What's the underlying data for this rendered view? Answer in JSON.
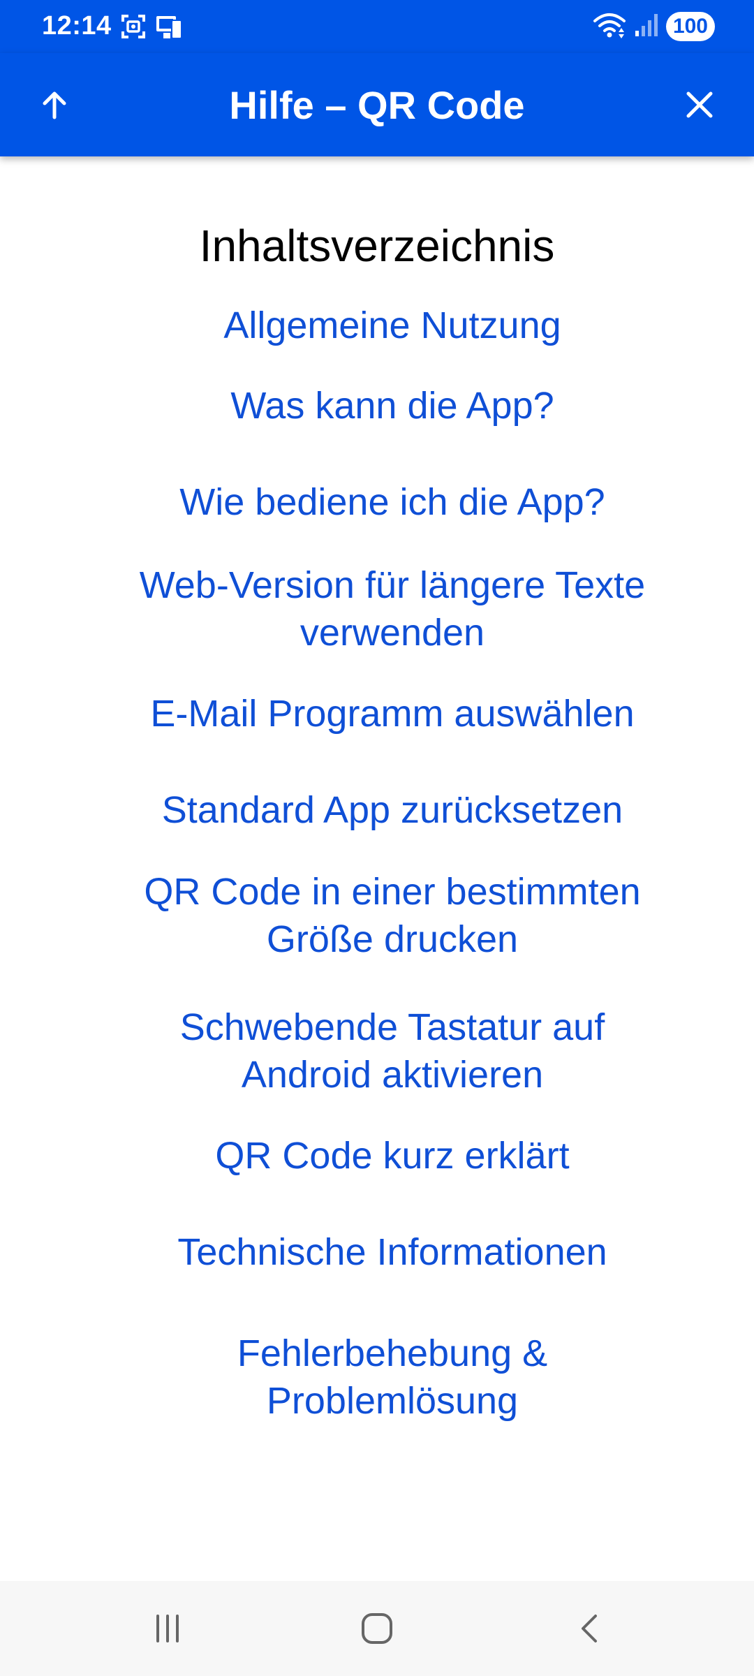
{
  "status_bar": {
    "time": "12:14",
    "battery": "100",
    "icons": [
      "screenshot-icon",
      "phone-link-icon",
      "wifi-icon",
      "signal-icon",
      "battery-icon"
    ]
  },
  "app_bar": {
    "title": "Hilfe – QR Code",
    "left_icon": "arrow-up-icon",
    "right_icon": "close-icon",
    "color": "#0055E6"
  },
  "toc": {
    "heading": "Inhaltsverzeichnis",
    "items": [
      [
        "Allgemeine Nutzung"
      ],
      [
        "Was kann die App?"
      ],
      [
        "Wie bediene ich die App?"
      ],
      [
        "Web-Version für längere Texte",
        "verwenden"
      ],
      [
        "E-Mail Programm auswählen"
      ],
      [
        "Standard App zurücksetzen"
      ],
      [
        "QR Code in einer bestimmten",
        "Größe drucken"
      ],
      [
        "Schwebende Tastatur auf",
        "Android aktivieren"
      ],
      [
        "QR Code kurz erklärt"
      ],
      [
        "Technische Informationen"
      ],
      [
        "Fehlerbehebung &",
        "Problemlösung"
      ]
    ],
    "link_color": "#0F4FD6"
  },
  "nav_bar": {
    "icons": [
      "recent-apps-icon",
      "home-icon",
      "back-icon"
    ]
  }
}
